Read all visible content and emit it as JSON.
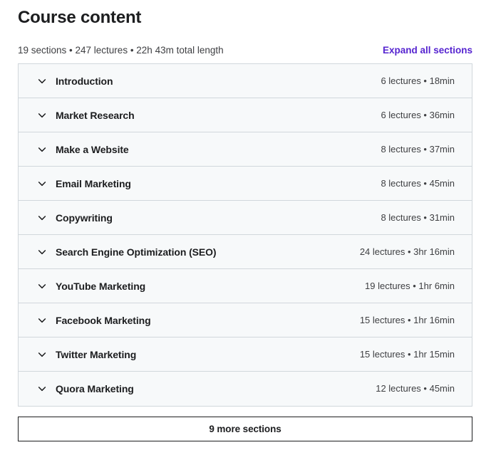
{
  "header": {
    "title": "Course content",
    "summary": "19 sections • 247 lectures • 22h 43m total length",
    "expand_all_label": "Expand all sections",
    "link_color": "#5624d0"
  },
  "sections": [
    {
      "title": "Introduction",
      "meta": "6 lectures • 18min"
    },
    {
      "title": "Market Research",
      "meta": "6 lectures • 36min"
    },
    {
      "title": "Make a Website",
      "meta": "8 lectures • 37min"
    },
    {
      "title": "Email Marketing",
      "meta": "8 lectures • 45min"
    },
    {
      "title": "Copywriting",
      "meta": "8 lectures • 31min"
    },
    {
      "title": "Search Engine Optimization (SEO)",
      "meta": "24 lectures • 3hr 16min"
    },
    {
      "title": "YouTube Marketing",
      "meta": "19 lectures • 1hr 6min"
    },
    {
      "title": "Facebook Marketing",
      "meta": "15 lectures • 1hr 16min"
    },
    {
      "title": "Twitter Marketing",
      "meta": "15 lectures • 1hr 15min"
    },
    {
      "title": "Quora Marketing",
      "meta": "12 lectures • 45min"
    }
  ],
  "footer": {
    "more_sections_label": "9 more sections"
  },
  "icons": {
    "section_toggle": "chevron-down-icon"
  },
  "colors": {
    "row_background": "#f7f9fa",
    "row_border": "#d1d7dc",
    "text_primary": "#1c1d1f",
    "text_secondary": "#3e3f42",
    "accent": "#5624d0"
  }
}
